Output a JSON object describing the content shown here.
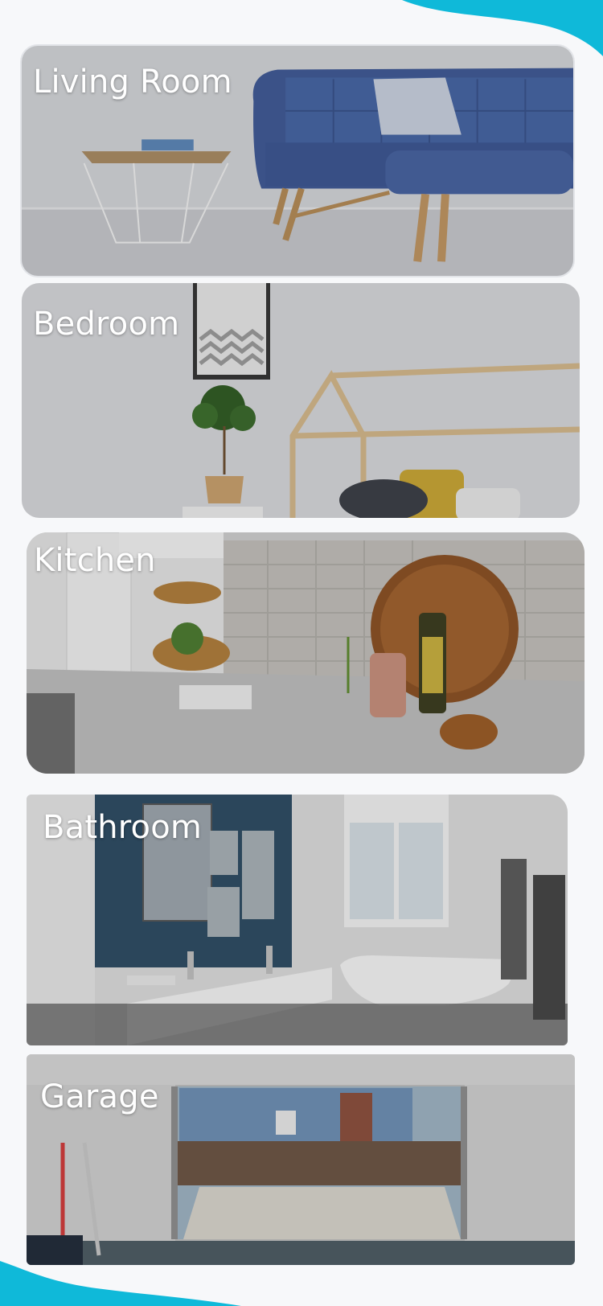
{
  "rooms": [
    {
      "id": "living",
      "label": "Living Room"
    },
    {
      "id": "bedroom",
      "label": "Bedroom"
    },
    {
      "id": "kitchen",
      "label": "Kitchen"
    },
    {
      "id": "bathroom",
      "label": "Bathroom"
    },
    {
      "id": "garage",
      "label": "Garage"
    }
  ],
  "colors": {
    "accent_wave": "#0fb9d9",
    "background": "#f7f8fa",
    "label": "#ffffff"
  }
}
